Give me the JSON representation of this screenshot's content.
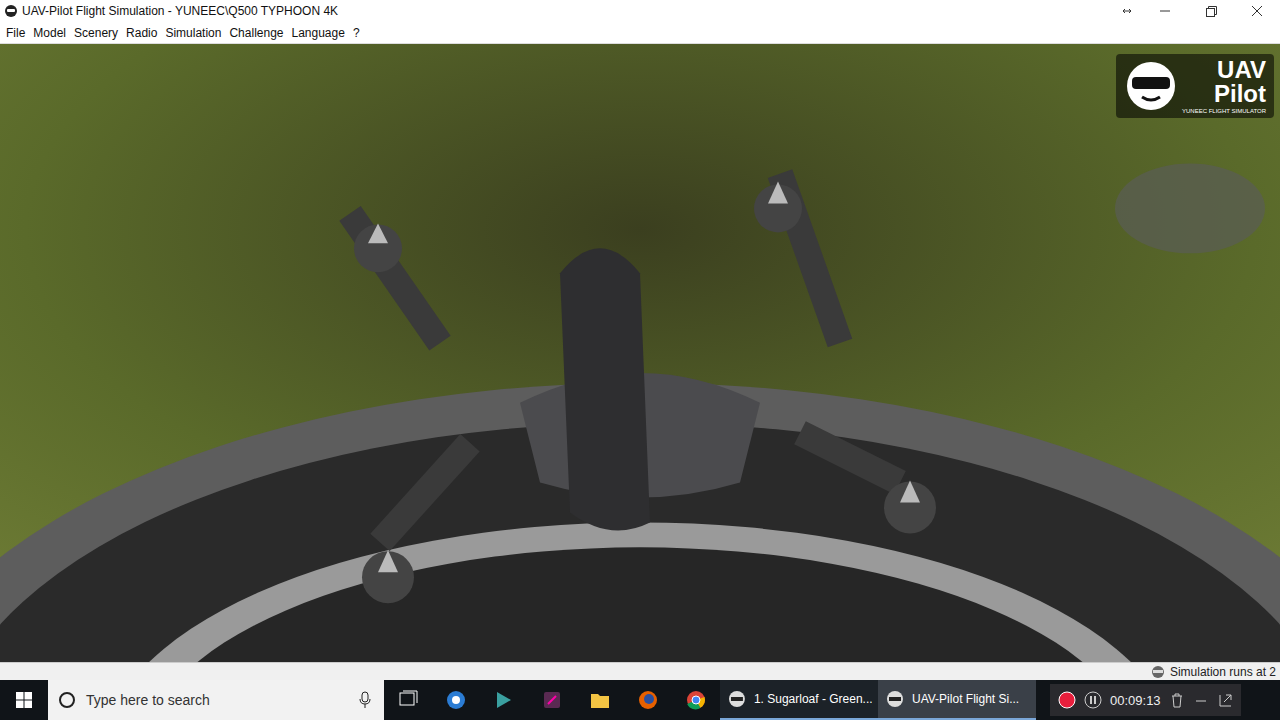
{
  "window": {
    "title": "UAV-Pilot Flight Simulation - YUNEEC\\Q500 TYPHOON 4K"
  },
  "menu": [
    "File",
    "Model",
    "Scenery",
    "Radio",
    "Simulation",
    "Challenge",
    "Language",
    "?"
  ],
  "logo": {
    "line1": "UAV",
    "line2": "Pilot",
    "tagline": "YUNEEC FLIGHT SIMULATOR"
  },
  "status_bar": {
    "text": "Simulation runs at 2"
  },
  "taskbar": {
    "search": {
      "placeholder": "Type here to search"
    },
    "apps": [
      {
        "label": "1. Sugarloaf - Green...",
        "selected": false
      },
      {
        "label": "UAV-Pilot Flight Si...",
        "selected": true
      }
    ],
    "recorder": {
      "recording": true,
      "time": "00:09:13"
    }
  }
}
